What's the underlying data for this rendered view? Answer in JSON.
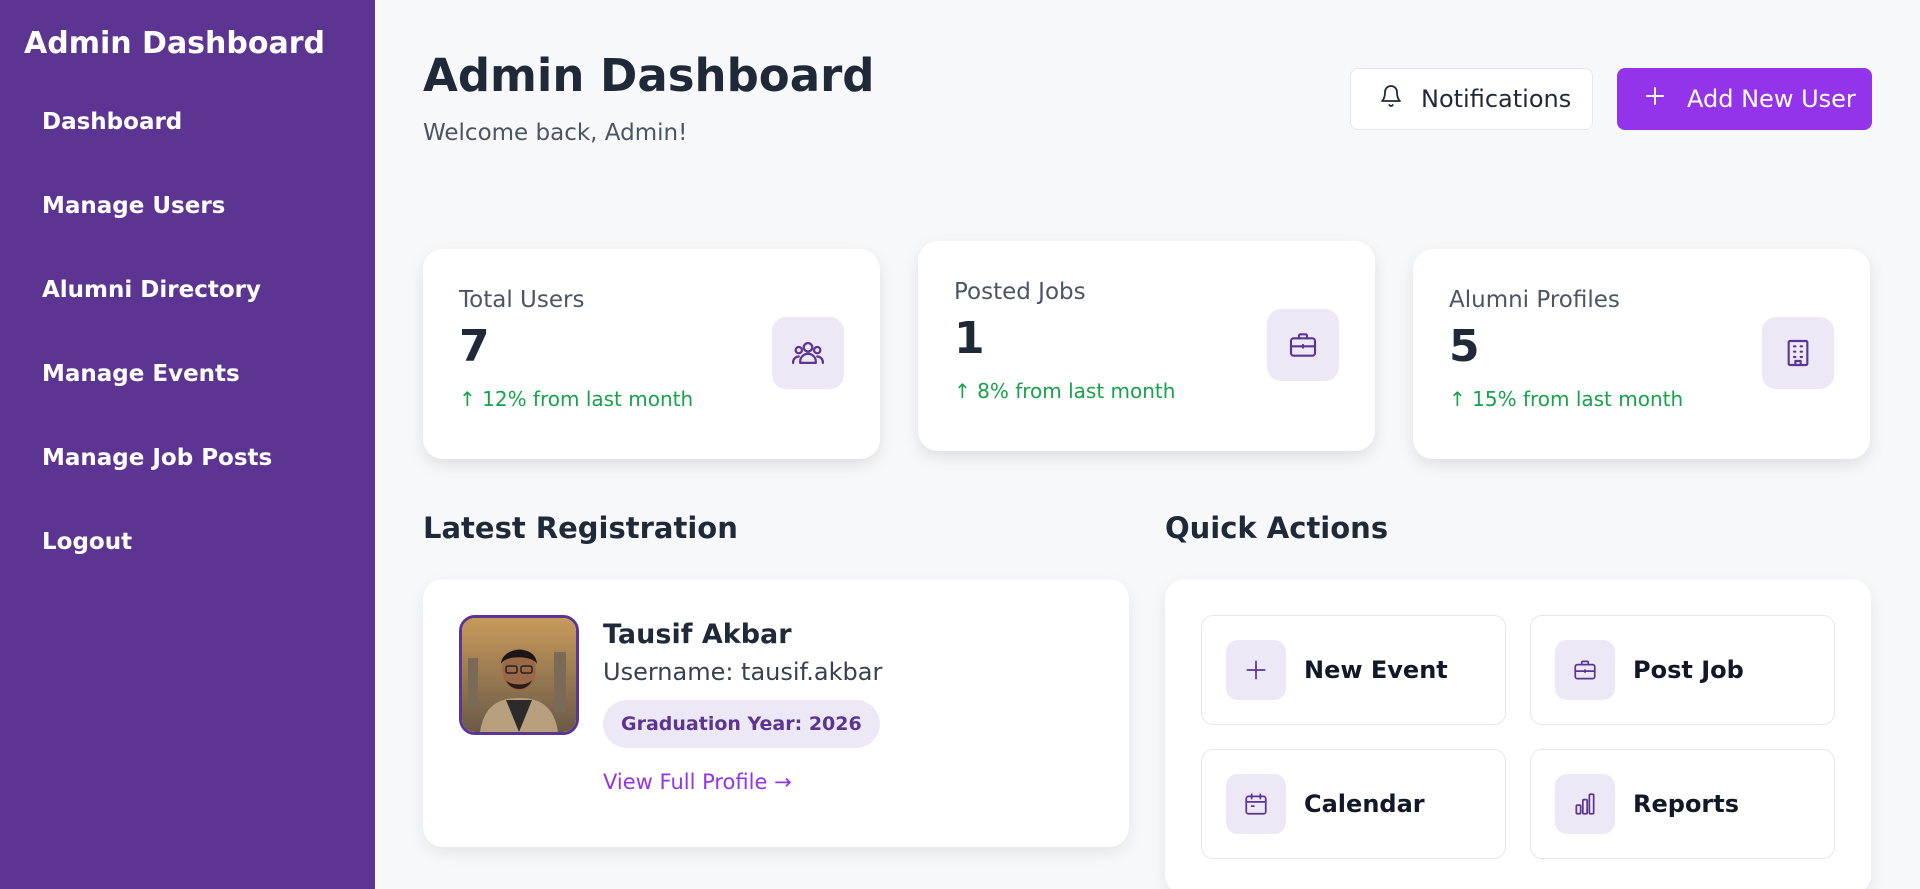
{
  "sidebar": {
    "title": "Admin Dashboard",
    "items": [
      {
        "label": "Dashboard"
      },
      {
        "label": "Manage Users"
      },
      {
        "label": "Alumni Directory"
      },
      {
        "label": "Manage Events"
      },
      {
        "label": "Manage Job Posts"
      },
      {
        "label": "Logout"
      }
    ]
  },
  "header": {
    "title": "Admin Dashboard",
    "subtitle": "Welcome back, Admin!",
    "notifications_label": "Notifications",
    "add_user_label": "Add New User"
  },
  "stats": [
    {
      "label": "Total Users",
      "value": "7",
      "trend": "↑ 12% from last month",
      "icon": "users-icon"
    },
    {
      "label": "Posted Jobs",
      "value": "1",
      "trend": "↑ 8% from last month",
      "icon": "briefcase-icon"
    },
    {
      "label": "Alumni Profiles",
      "value": "5",
      "trend": "↑ 15% from last month",
      "icon": "building-icon"
    }
  ],
  "latest_registration": {
    "section_title": "Latest Registration",
    "name": "Tausif Akbar",
    "username": "Username: tausif.akbar",
    "graduation": "Graduation Year: 2026",
    "link": "View Full Profile →"
  },
  "quick_actions": {
    "section_title": "Quick Actions",
    "items": [
      {
        "label": "New Event",
        "icon": "plus-icon"
      },
      {
        "label": "Post Job",
        "icon": "briefcase-icon"
      },
      {
        "label": "Calendar",
        "icon": "calendar-icon"
      },
      {
        "label": "Reports",
        "icon": "bar-chart-icon"
      }
    ]
  },
  "colors": {
    "sidebar": "#5c3593",
    "accent": "#9333ea",
    "trend_positive": "#16a34a",
    "icon_bg": "#ede8f5"
  }
}
